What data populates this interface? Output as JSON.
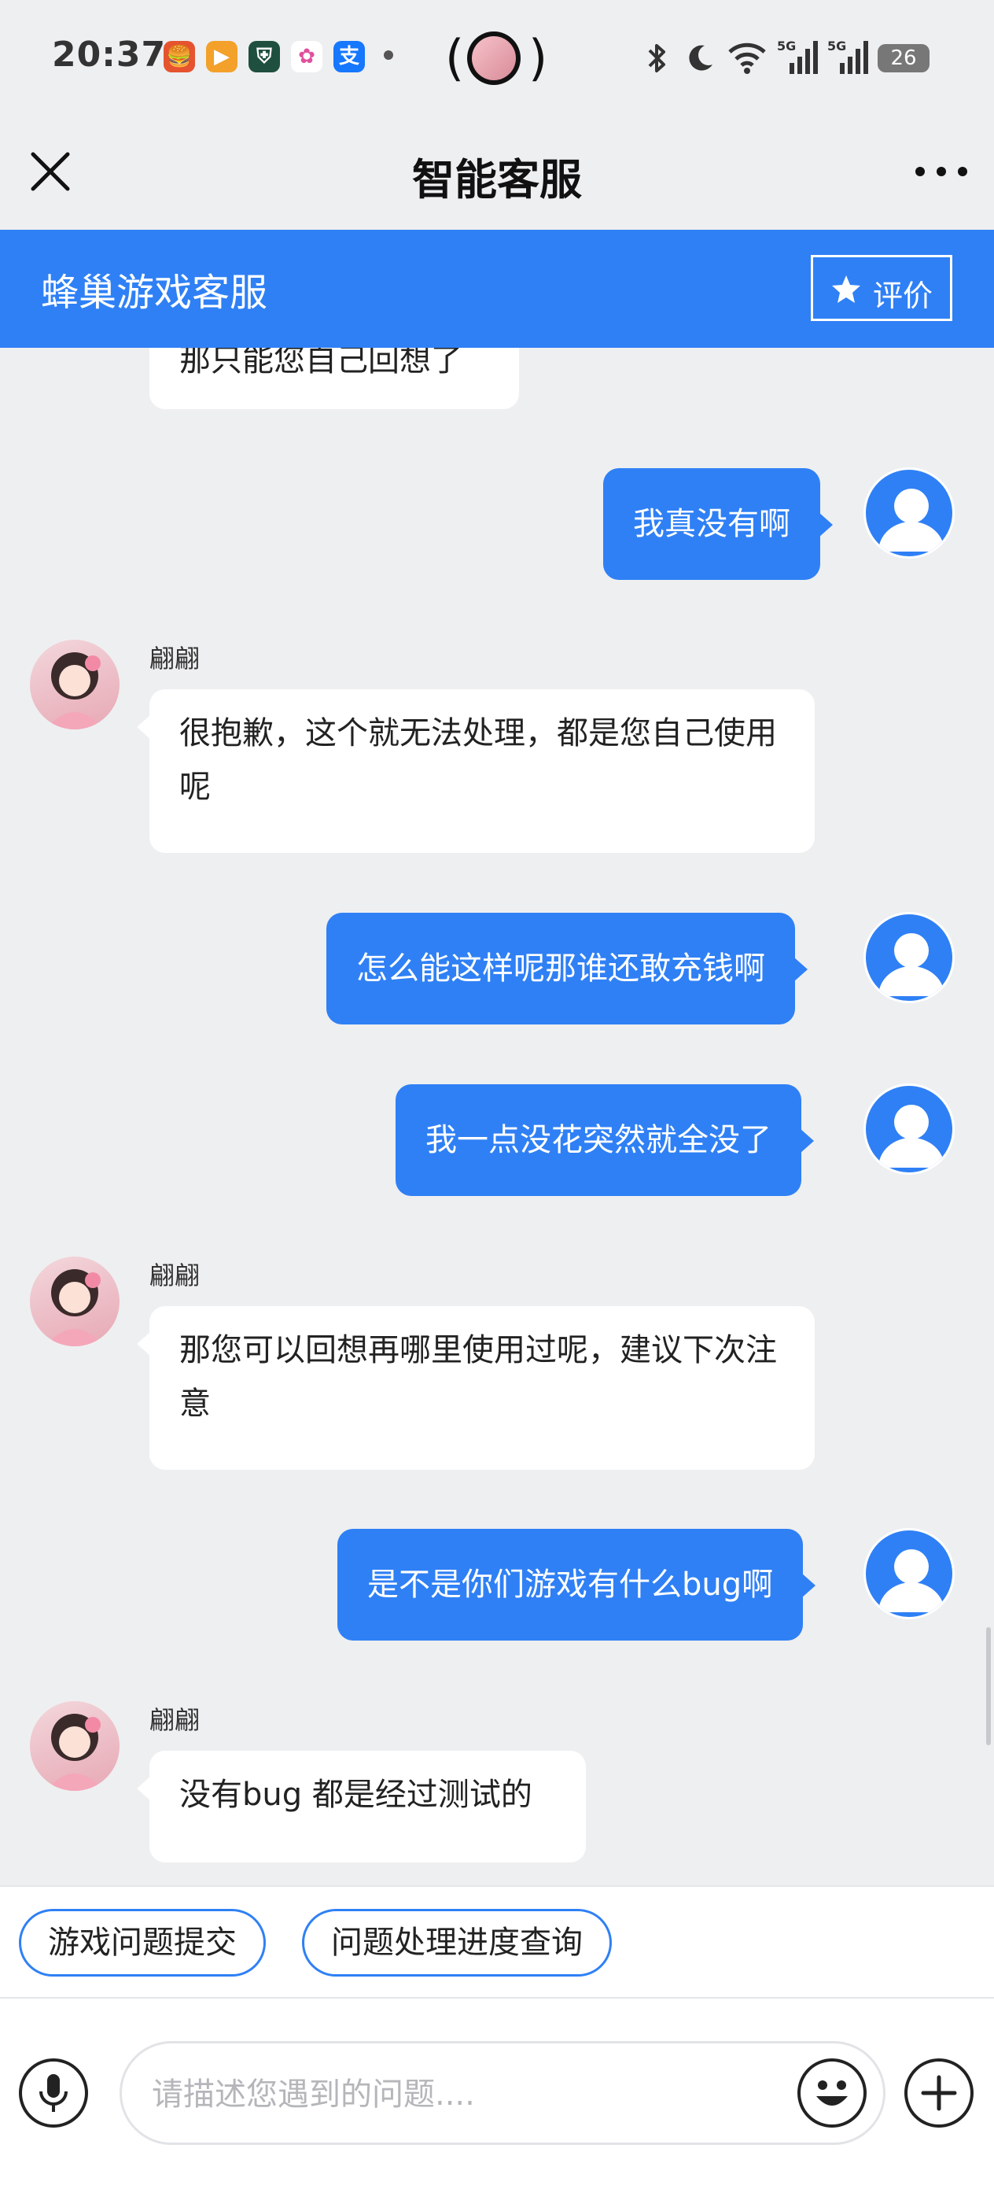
{
  "status_bar": {
    "time": "20:37",
    "app_icons": [
      {
        "name": "food-app-icon",
        "glyph": "🍔",
        "color": "#e5532f"
      },
      {
        "name": "video-app-icon",
        "glyph": "▶",
        "color": "#f3a12a"
      },
      {
        "name": "security-app-icon",
        "glyph": "⛨",
        "color": "#1f4f3f"
      },
      {
        "name": "photos-app-icon",
        "glyph": "✿",
        "color": "#ffffff"
      },
      {
        "name": "alipay-app-icon",
        "glyph": "支",
        "color": "#1677ff"
      }
    ],
    "battery": "26"
  },
  "nav": {
    "title": "智能客服"
  },
  "header": {
    "title": "蜂巢游戏客服",
    "rate_label": "评价"
  },
  "messages": [
    {
      "from": "agent",
      "text": "那只能您自己回想了",
      "partial": true
    },
    {
      "from": "user",
      "text": "我真没有啊"
    },
    {
      "from": "agent",
      "name": "翩翩",
      "text": "很抱歉，这个就无法处理，都是您自己使用呢"
    },
    {
      "from": "user",
      "text": "怎么能这样呢那谁还敢充钱啊"
    },
    {
      "from": "user",
      "text": "我一点没花突然就全没了"
    },
    {
      "from": "agent",
      "name": "翩翩",
      "text": "那您可以回想再哪里使用过呢，建议下次注意"
    },
    {
      "from": "user",
      "text": "是不是你们游戏有什么bug啊"
    },
    {
      "from": "agent",
      "name": "翩翩",
      "text": "没有bug 都是经过测试的"
    }
  ],
  "quick_actions": [
    {
      "label": "游戏问题提交"
    },
    {
      "label": "问题处理进度查询"
    }
  ],
  "input": {
    "placeholder": "请描述您遇到的问题....",
    "value": ""
  },
  "colors": {
    "accent": "#2f80f5",
    "background": "#eeeff1"
  }
}
